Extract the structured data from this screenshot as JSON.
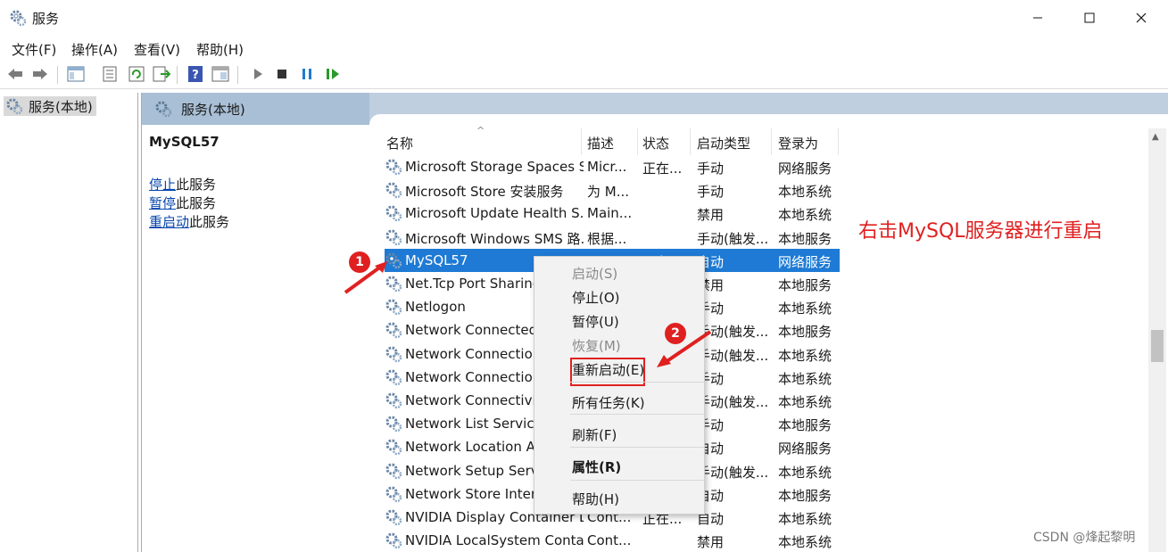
{
  "window": {
    "title": "服务"
  },
  "menu": [
    "文件(F)",
    "操作(A)",
    "查看(V)",
    "帮助(H)"
  ],
  "toolbar": [
    "back-icon",
    "forward-icon",
    "console-tree-icon",
    "properties-icon",
    "refresh-icon",
    "export-icon",
    "help-icon",
    "view-icon",
    "start-icon",
    "stop-icon",
    "pause-icon",
    "restart-icon"
  ],
  "tree": {
    "item": "服务(本地)"
  },
  "pane": {
    "title": "服务(本地)"
  },
  "detail": {
    "service_name": "MySQL57",
    "actions": [
      {
        "link": "停止",
        "suffix": "此服务"
      },
      {
        "link": "暂停",
        "suffix": "此服务"
      },
      {
        "link": "重启动",
        "suffix": "此服务"
      }
    ]
  },
  "table": {
    "columns": [
      "名称",
      "描述",
      "状态",
      "启动类型",
      "登录为"
    ],
    "rows": [
      [
        "Microsoft Storage Spaces S...",
        "Micr...",
        "正在...",
        "手动",
        "网络服务"
      ],
      [
        "Microsoft Store 安装服务",
        "为 M...",
        "",
        "手动",
        "本地系统"
      ],
      [
        "Microsoft Update Health S...",
        "Main...",
        "",
        "禁用",
        "本地系统"
      ],
      [
        "Microsoft Windows SMS 路...",
        "根据...",
        "",
        "手动(触发...",
        "本地服务"
      ],
      [
        "MySQL57",
        "",
        "正在...",
        "自动",
        "网络服务"
      ],
      [
        "Net.Tcp Port Sharing",
        "",
        "",
        "禁用",
        "本地服务"
      ],
      [
        "Netlogon",
        "",
        "",
        "手动",
        "本地系统"
      ],
      [
        "Network Connected D",
        "",
        "",
        "手动(触发...",
        "本地服务"
      ],
      [
        "Network Connection",
        "",
        "",
        "手动(触发...",
        "本地系统"
      ],
      [
        "Network Connections",
        "",
        "",
        "手动",
        "本地系统"
      ],
      [
        "Network Connectivity",
        "",
        "",
        "手动(触发...",
        "本地系统"
      ],
      [
        "Network List Service",
        "",
        "",
        "手动",
        "本地服务"
      ],
      [
        "Network Location Aw",
        "",
        "",
        "自动",
        "网络服务"
      ],
      [
        "Network Setup Servic",
        "",
        "",
        "手动(触发...",
        "本地系统"
      ],
      [
        "Network Store Interfa",
        "",
        "",
        "自动",
        "本地服务"
      ],
      [
        "NVIDIA Display Container LS",
        "Cont...",
        "正在...",
        "自动",
        "本地系统"
      ],
      [
        "NVIDIA LocalSystem Conta...",
        "Cont...",
        "",
        "禁用",
        "本地系统"
      ]
    ],
    "selected_index": 4
  },
  "context_menu": [
    {
      "label": "启动(S)",
      "disabled": true
    },
    {
      "label": "停止(O)"
    },
    {
      "label": "暂停(U)"
    },
    {
      "label": "恢复(M)",
      "disabled": true
    },
    {
      "label": "重新启动(E)",
      "highlighted": true
    },
    {
      "label": "所有任务(K)",
      "submenu": true
    },
    {
      "label": "刷新(F)"
    },
    {
      "label": "属性(R)",
      "bold": true
    },
    {
      "label": "帮助(H)"
    }
  ],
  "annotations": {
    "note": "右击MySQL服务器进行重启",
    "badge1": "1",
    "badge2": "2",
    "watermark": "CSDN @烽起黎明",
    "color": "#e02020"
  },
  "colors": {
    "selection": "#1e7ad4",
    "header": "#bfcfe0",
    "link": "#0645ad"
  }
}
